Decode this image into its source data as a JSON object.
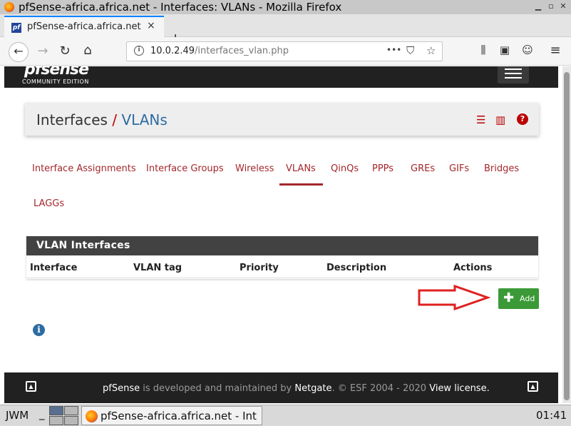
{
  "window": {
    "title": "pfSense-africa.africa.net - Interfaces: VLANs - Mozilla Firefox"
  },
  "browser": {
    "tab_label": "pfSense-africa.africa.net",
    "tab_close": "×",
    "new_tab": "+",
    "url_host": "10.0.2.49",
    "url_path": "/interfaces_vlan.php",
    "url_more": "•••"
  },
  "pfsense": {
    "logo": "pfsense",
    "edition": "COMMUNITY EDITION"
  },
  "breadcrumb": {
    "section": "Interfaces",
    "separator": "/",
    "page": "VLANs"
  },
  "tabs": [
    {
      "label": "Interface Assignments",
      "active": false
    },
    {
      "label": "Interface Groups",
      "active": false
    },
    {
      "label": "Wireless",
      "active": false
    },
    {
      "label": "VLANs",
      "active": true
    },
    {
      "label": "QinQs",
      "active": false
    },
    {
      "label": "PPPs",
      "active": false
    },
    {
      "label": "GREs",
      "active": false
    },
    {
      "label": "GIFs",
      "active": false
    },
    {
      "label": "Bridges",
      "active": false
    },
    {
      "label": "LAGGs",
      "active": false
    }
  ],
  "panel": {
    "title": "VLAN Interfaces",
    "columns": [
      "Interface",
      "VLAN tag",
      "Priority",
      "Description",
      "Actions"
    ],
    "rows": []
  },
  "add_button": {
    "label": "Add"
  },
  "footer": {
    "brand": "pfSense",
    "text1": " is developed and maintained by ",
    "company": "Netgate",
    "text2": ". © ESF 2004 - 2020 ",
    "license": "View license."
  },
  "taskbar": {
    "wm": "JWM",
    "underscore": "_",
    "task_title": "pfSense-africa.africa.net - Int",
    "clock": "01:41"
  },
  "colors": {
    "accent_red": "#a4272b",
    "link_blue": "#2d6ca2",
    "add_green": "#3b9a37",
    "header_dark": "#212121"
  }
}
